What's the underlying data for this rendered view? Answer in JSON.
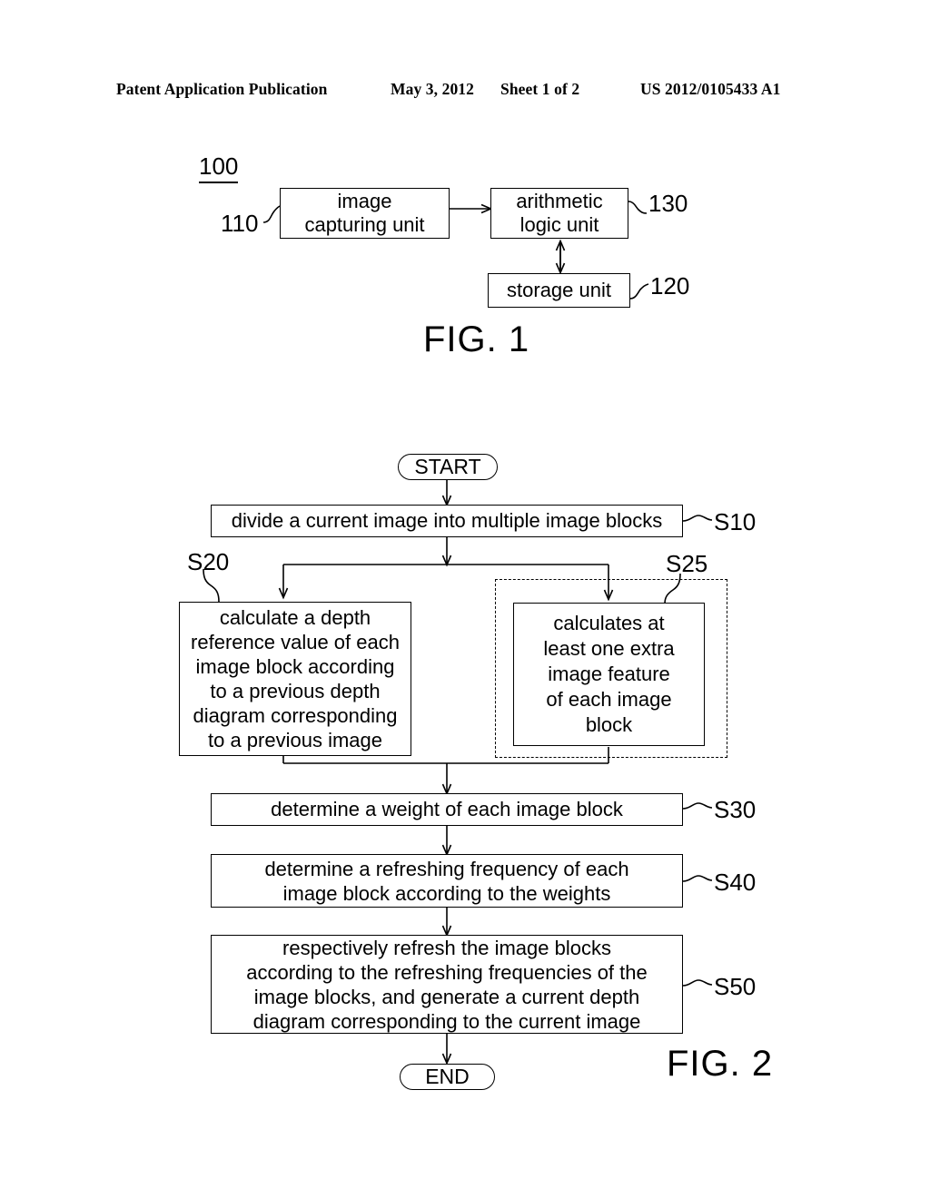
{
  "header": {
    "publication": "Patent Application Publication",
    "date": "May 3, 2012",
    "sheet": "Sheet 1 of 2",
    "document_number": "US 2012/0105433 A1"
  },
  "figure1": {
    "caption": "FIG. 1",
    "system_ref": "100",
    "blocks": [
      {
        "ref": "110",
        "label": "image\ncapturing unit"
      },
      {
        "ref": "130",
        "label": "arithmetic\nlogic unit"
      },
      {
        "ref": "120",
        "label": "storage unit"
      }
    ]
  },
  "figure2": {
    "caption": "FIG. 2",
    "start_label": "START",
    "end_label": "END",
    "steps": [
      {
        "ref": "S10",
        "text": "divide a current image into multiple image blocks"
      },
      {
        "ref": "S20",
        "text": "calculate a depth\nreference value of each\nimage block according\nto a previous depth\ndiagram corresponding\nto a previous image"
      },
      {
        "ref": "S25",
        "text": "calculates at\nleast one extra\nimage feature\nof each image\nblock"
      },
      {
        "ref": "S30",
        "text": "determine a weight of each image block"
      },
      {
        "ref": "S40",
        "text": "determine a refreshing frequency of each\nimage block according to the weights"
      },
      {
        "ref": "S50",
        "text": "respectively refresh the image blocks\naccording to the refreshing frequencies of the\nimage blocks, and generate a current depth\ndiagram corresponding to the current image"
      }
    ]
  },
  "colors": {
    "ink": "#000000",
    "paper": "#ffffff"
  }
}
